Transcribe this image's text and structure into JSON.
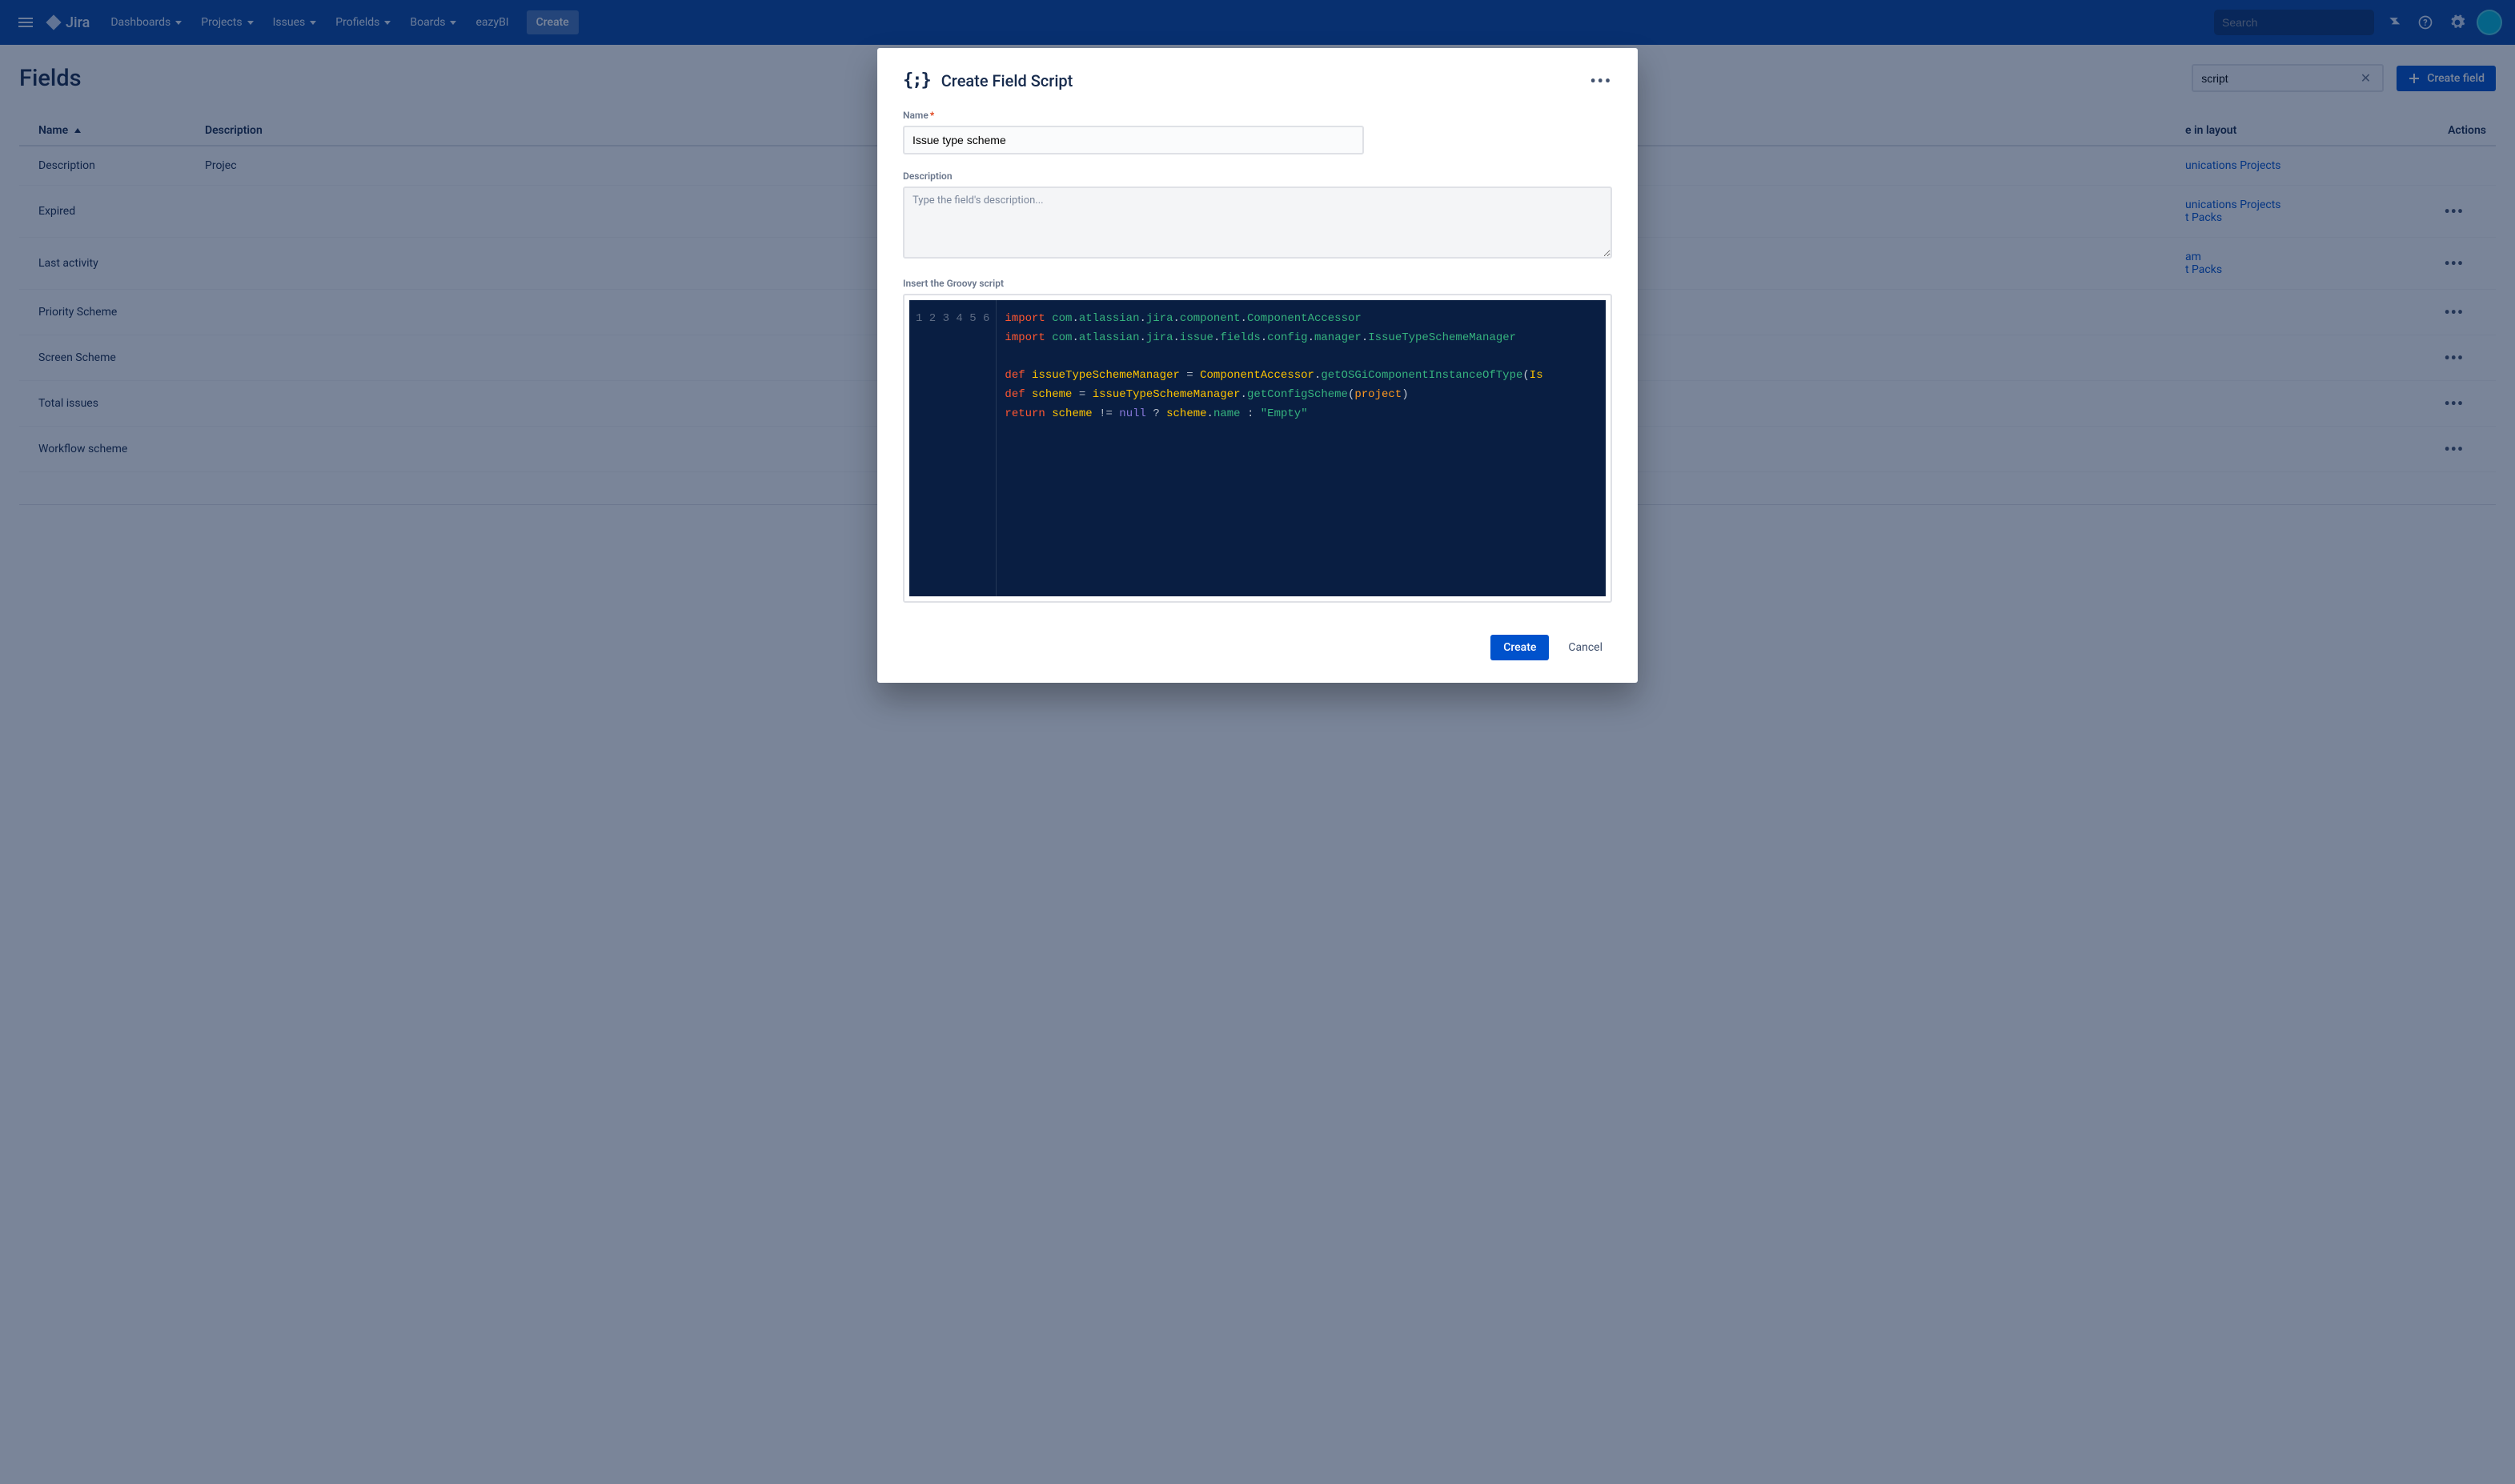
{
  "nav": {
    "product": "Jira",
    "items": [
      "Dashboards",
      "Projects",
      "Issues",
      "Profields",
      "Boards",
      "eazyBI"
    ],
    "create": "Create",
    "search_placeholder": "Search"
  },
  "page": {
    "title": "Fields",
    "filter_value": "script",
    "create_button": "Create field"
  },
  "table": {
    "columns": {
      "name": "Name",
      "description": "Description",
      "layout": "e in layout",
      "actions": "Actions"
    },
    "rows": [
      {
        "name": "Description",
        "desc_prefix": "Projec",
        "layout_links": [
          "unications Projects"
        ],
        "actions": false
      },
      {
        "name": "Expired",
        "desc_prefix": "",
        "layout_links": [
          "unications Projects",
          "t Packs"
        ],
        "actions": true
      },
      {
        "name": "Last activity",
        "desc_prefix": "",
        "layout_links": [
          "am",
          "t Packs"
        ],
        "actions": true
      },
      {
        "name": "Priority Scheme",
        "desc_prefix": "",
        "layout_links": [],
        "actions": true
      },
      {
        "name": "Screen Scheme",
        "desc_prefix": "",
        "layout_links": [],
        "actions": true
      },
      {
        "name": "Total issues",
        "desc_prefix": "",
        "layout_links": [],
        "actions": true
      },
      {
        "name": "Workflow scheme",
        "desc_prefix": "",
        "layout_links": [],
        "actions": true
      }
    ]
  },
  "modal": {
    "title": "Create Field Script",
    "name_label": "Name",
    "name_value": "Issue type scheme",
    "desc_label": "Description",
    "desc_placeholder": "Type the field's description...",
    "script_label": "Insert the Groovy script",
    "create": "Create",
    "cancel": "Cancel",
    "code": {
      "lines": [
        1,
        2,
        3,
        4,
        5,
        6
      ],
      "l1": {
        "kw": "import",
        "path": "com.atlassian.jira.component.ComponentAccessor"
      },
      "l2": {
        "kw": "import",
        "path": "com.atlassian.jira.issue.fields.config.manager.IssueTypeSchemeManager"
      },
      "l4": {
        "kw": "def",
        "var": "issueTypeSchemeManager",
        "eq": "=",
        "obj": "ComponentAccessor",
        "fn": "getOSGiComponentInstanceOfType",
        "arg": "Is"
      },
      "l5": {
        "kw": "def",
        "var": "scheme",
        "eq": "=",
        "obj": "issueTypeSchemeManager",
        "fn": "getConfigScheme",
        "arg": "project"
      },
      "l6": {
        "kw": "return",
        "var": "scheme",
        "op1": "!=",
        "null": "null",
        "op2": "?",
        "obj": "scheme",
        "prop": "name",
        "op3": ":",
        "str": "\"Empty\""
      }
    }
  }
}
